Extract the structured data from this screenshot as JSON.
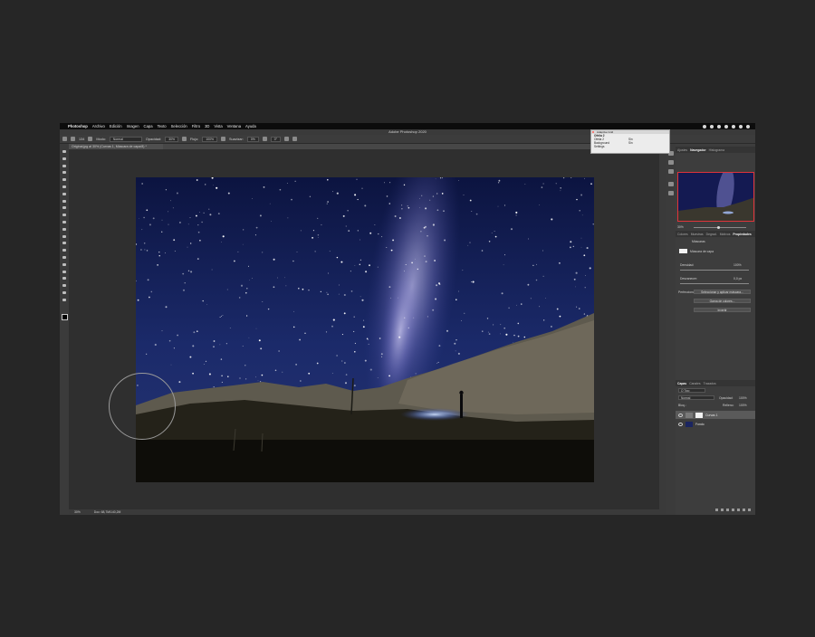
{
  "menubar": {
    "apple": "",
    "items": [
      "Photoshop",
      "Archivo",
      "Edición",
      "Imagen",
      "Capa",
      "Texto",
      "Selección",
      "Filtro",
      "3D",
      "Vista",
      "Ventana",
      "Ayuda"
    ]
  },
  "window": {
    "title": "Adobe Photoshop 2020"
  },
  "options": {
    "mode_label": "Modo:",
    "mode_value": "Normal",
    "opacity_label": "Opacidad:",
    "opacity_value": "30%",
    "flow_label": "Flujo:",
    "flow_value": "100%",
    "smoothing_label": "Suavizar:",
    "smoothing_value": "0%",
    "angle_value": "0°",
    "brush_size": "134"
  },
  "document": {
    "tab_label": "Original.jpg al 30% (Curvas 1, Máscara de capa/8) *",
    "zoom": "30%",
    "doc_info": "Doc: 68,7M/140,2M"
  },
  "floating_window": {
    "title": "Adaptive Grid",
    "item": "Ofelia 2",
    "rows": [
      {
        "name": "Ofelia 2",
        "value": "Sin"
      },
      {
        "name": "Background",
        "value": "Sin"
      }
    ],
    "settings": "Settings"
  },
  "panels": {
    "top_tabs": [
      "Ajustes",
      "Navegador",
      "Histograma"
    ],
    "top_active": "Navegador",
    "nav_zoom": "30%",
    "props_tabs": [
      "Colores",
      "Muestras",
      "Degrad.",
      "Motivos",
      "Propiedades"
    ],
    "props_active": "Propiedades",
    "masks_label": "Máscaras",
    "mask_type": "Máscara de capa",
    "density_label": "Densidad:",
    "density_value": "100%",
    "feather_label": "Desvanecer:",
    "feather_value": "0,0 px",
    "refine_label": "Perfeccionar:",
    "btn_select_mask": "Seleccionar y aplicar máscara...",
    "btn_color_range": "Gama de colores...",
    "btn_invert": "Invertir",
    "layers_tabs": [
      "Capas",
      "Canales",
      "Trazados"
    ],
    "layers_active": "Capas",
    "kind_filter": "Q Tipo",
    "blend_mode": "Normal",
    "opacity_label": "Opacidad:",
    "opacity_value": "100%",
    "lock_label": "Bloq.:",
    "fill_label": "Relleno:",
    "fill_value": "100%",
    "layers": [
      {
        "name": "Curvas 1",
        "selected": true
      },
      {
        "name": "Fondo",
        "selected": false
      }
    ]
  },
  "colors": {
    "accent_red": "#e0333a",
    "panel_bg": "#3d3d3d",
    "desktop_bg": "#262626"
  }
}
